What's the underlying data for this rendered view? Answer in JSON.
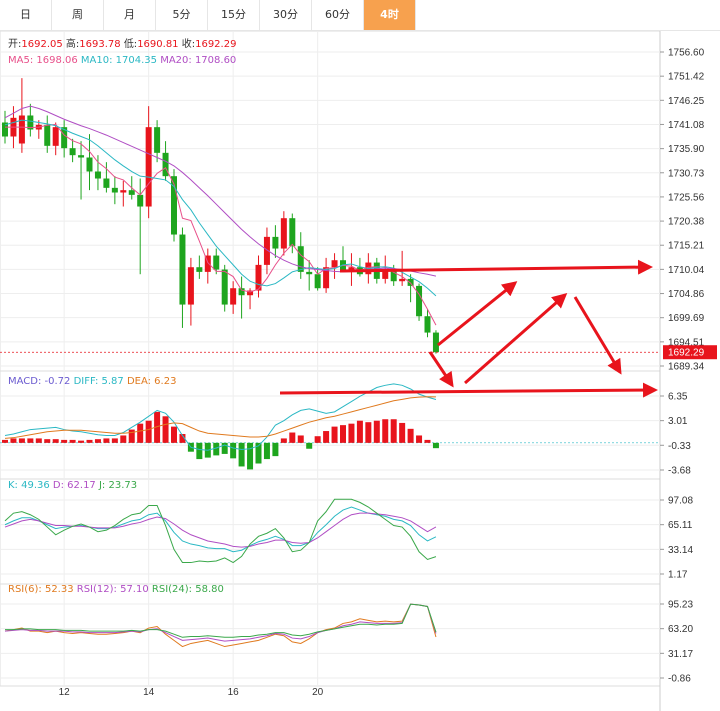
{
  "tabs": [
    {
      "label": "日",
      "active": false
    },
    {
      "label": "周",
      "active": false
    },
    {
      "label": "月",
      "active": false
    },
    {
      "label": "5分",
      "active": false
    },
    {
      "label": "15分",
      "active": false
    },
    {
      "label": "30分",
      "active": false
    },
    {
      "label": "60分",
      "active": false
    },
    {
      "label": "4时",
      "active": true
    }
  ],
  "ohlc_info": [
    {
      "label": "开:",
      "value": "1692.05"
    },
    {
      "label": "高:",
      "value": "1693.78"
    },
    {
      "label": "低:",
      "value": "1690.81"
    },
    {
      "label": "收:",
      "value": "1692.29"
    }
  ],
  "ma_info": [
    {
      "label": "MA5: ",
      "value": "1698.06",
      "color": "#e8508a"
    },
    {
      "label": "MA10: ",
      "value": "1704.35",
      "color": "#2bb8c4"
    },
    {
      "label": "MA20: ",
      "value": "1708.60",
      "color": "#b04ec4"
    }
  ],
  "macd_info": [
    {
      "label": "MACD: ",
      "value": "-0.72",
      "color": "#6b5bd0"
    },
    {
      "label": "DIFF: ",
      "value": "5.87",
      "color": "#2bb8c4"
    },
    {
      "label": "DEA: ",
      "value": "6.23",
      "color": "#e07a1f"
    }
  ],
  "kdj_info": [
    {
      "label": "K: ",
      "value": "49.36",
      "color": "#2bb8c4"
    },
    {
      "label": "D: ",
      "value": "62.17",
      "color": "#b04ec4"
    },
    {
      "label": "J: ",
      "value": "23.73",
      "color": "#3aa84a"
    }
  ],
  "rsi_info": [
    {
      "label": "RSI(6): ",
      "value": "52.33",
      "color": "#e07a1f"
    },
    {
      "label": "RSI(12): ",
      "value": "57.10",
      "color": "#b04ec4"
    },
    {
      "label": "RSI(24): ",
      "value": "58.80",
      "color": "#3aa84a"
    }
  ],
  "colors": {
    "up": "#e8141c",
    "down": "#1ea51e",
    "grid": "#eeeeee",
    "arrow": "#e8141c",
    "price_tag": "#e8141c"
  },
  "chart_data": [
    {
      "type": "candlestick",
      "name": "price",
      "y_ticks": [
        1756.6,
        1751.42,
        1746.25,
        1741.08,
        1735.9,
        1730.73,
        1725.56,
        1720.38,
        1715.21,
        1710.04,
        1704.86,
        1699.69,
        1694.51,
        1689.34
      ],
      "y_range": [
        1689.34,
        1756.6
      ],
      "x_tick_labels": [
        {
          "label": "12",
          "index": 7
        },
        {
          "label": "14",
          "index": 17
        },
        {
          "label": "16",
          "index": 27
        },
        {
          "label": "20",
          "index": 37
        }
      ],
      "current_price": 1692.29,
      "candles": [
        [
          1741.5,
          1744.0,
          1737.0,
          1738.5
        ],
        [
          1738.5,
          1745.0,
          1736.0,
          1742.5
        ],
        [
          1737.0,
          1751.0,
          1735.0,
          1743.0
        ],
        [
          1743.0,
          1745.5,
          1738.5,
          1740.0
        ],
        [
          1740.0,
          1742.0,
          1738.0,
          1741.0
        ],
        [
          1741.0,
          1743.0,
          1735.0,
          1736.5
        ],
        [
          1736.5,
          1741.5,
          1734.5,
          1740.5
        ],
        [
          1740.5,
          1742.0,
          1734.0,
          1736.0
        ],
        [
          1736.0,
          1738.0,
          1733.0,
          1734.5
        ],
        [
          1734.5,
          1737.5,
          1725.0,
          1734.0
        ],
        [
          1734.0,
          1739.0,
          1727.0,
          1731.0
        ],
        [
          1731.0,
          1734.5,
          1727.0,
          1729.5
        ],
        [
          1729.5,
          1733.0,
          1726.5,
          1727.5
        ],
        [
          1727.5,
          1730.0,
          1724.0,
          1726.5
        ],
        [
          1726.5,
          1729.0,
          1723.5,
          1727.0
        ],
        [
          1727.0,
          1730.0,
          1725.0,
          1726.0
        ],
        [
          1726.0,
          1729.5,
          1709.0,
          1723.5
        ],
        [
          1723.5,
          1745.0,
          1721.0,
          1740.5
        ],
        [
          1740.5,
          1742.0,
          1733.0,
          1735.0
        ],
        [
          1735.0,
          1737.5,
          1729.0,
          1730.0
        ],
        [
          1730.0,
          1731.5,
          1716.0,
          1717.5
        ],
        [
          1717.5,
          1719.0,
          1697.5,
          1702.5
        ],
        [
          1702.5,
          1712.5,
          1698.0,
          1710.5
        ],
        [
          1710.5,
          1713.0,
          1708.0,
          1709.5
        ],
        [
          1709.5,
          1714.5,
          1707.0,
          1713.0
        ],
        [
          1713.0,
          1714.5,
          1709.0,
          1710.0
        ],
        [
          1710.0,
          1711.0,
          1701.0,
          1702.5
        ],
        [
          1702.5,
          1707.5,
          1700.5,
          1706.0
        ],
        [
          1706.0,
          1708.5,
          1699.5,
          1704.5
        ],
        [
          1704.5,
          1706.0,
          1701.5,
          1705.5
        ],
        [
          1705.5,
          1713.0,
          1704.0,
          1711.0
        ],
        [
          1711.0,
          1719.0,
          1709.0,
          1717.0
        ],
        [
          1717.0,
          1719.5,
          1712.5,
          1714.5
        ],
        [
          1714.5,
          1722.5,
          1713.0,
          1721.0
        ],
        [
          1721.0,
          1722.0,
          1713.5,
          1715.0
        ],
        [
          1715.0,
          1718.0,
          1708.0,
          1709.5
        ],
        [
          1709.5,
          1712.0,
          1705.5,
          1709.0
        ],
        [
          1709.0,
          1710.5,
          1705.5,
          1706.0
        ],
        [
          1706.0,
          1712.5,
          1705.0,
          1710.5
        ],
        [
          1710.5,
          1713.5,
          1708.0,
          1712.0
        ],
        [
          1712.0,
          1715.0,
          1710.0,
          1709.5
        ],
        [
          1709.5,
          1713.5,
          1706.5,
          1710.5
        ],
        [
          1710.5,
          1712.5,
          1708.5,
          1709.0
        ],
        [
          1709.0,
          1713.5,
          1707.0,
          1711.5
        ],
        [
          1711.5,
          1712.5,
          1707.0,
          1708.0
        ],
        [
          1708.0,
          1713.0,
          1707.0,
          1710.0
        ],
        [
          1710.0,
          1711.0,
          1706.5,
          1707.5
        ],
        [
          1707.5,
          1714.0,
          1706.5,
          1708.0
        ],
        [
          1708.0,
          1709.0,
          1703.0,
          1706.5
        ],
        [
          1706.5,
          1707.0,
          1699.0,
          1700.0
        ],
        [
          1700.0,
          1701.5,
          1695.5,
          1696.5
        ],
        [
          1696.5,
          1697.0,
          1692.0,
          1692.29
        ]
      ],
      "ma5": [
        1740.5,
        1740.5,
        1740.5,
        1740.4,
        1740.5,
        1740.9,
        1741.1,
        1738.8,
        1737.6,
        1736.9,
        1735.3,
        1733.0,
        1731.6,
        1729.8,
        1729.2,
        1727.5,
        1726.0,
        1728.4,
        1730.6,
        1731.8,
        1728.3,
        1721.0,
        1720.5,
        1716.1,
        1711.5,
        1709.6,
        1709.6,
        1708.5,
        1705.6,
        1705.2,
        1705.8,
        1708.1,
        1711.0,
        1713.5,
        1715.4,
        1713.1,
        1711.7,
        1709.0,
        1710.2,
        1710.4,
        1710.9,
        1710.7,
        1709.8,
        1710.5,
        1710.6,
        1710.5,
        1709.4,
        1708.5,
        1707.1,
        1704.7,
        1701.5,
        1698.1
      ],
      "ma10": [
        1741.0,
        1741.5,
        1742.0,
        1741.8,
        1741.5,
        1741.2,
        1740.8,
        1740.0,
        1739.2,
        1738.5,
        1737.8,
        1736.5,
        1735.0,
        1733.5,
        1732.2,
        1731.0,
        1730.0,
        1729.8,
        1729.5,
        1729.2,
        1727.8,
        1725.0,
        1722.8,
        1720.0,
        1717.5,
        1715.0,
        1713.0,
        1711.0,
        1709.0,
        1707.5,
        1706.8,
        1706.5,
        1707.0,
        1708.2,
        1709.5,
        1710.0,
        1710.4,
        1710.2,
        1710.0,
        1710.2,
        1711.0,
        1711.2,
        1710.6,
        1710.2,
        1710.5,
        1710.6,
        1710.3,
        1709.4,
        1708.4,
        1707.4,
        1706.0,
        1704.35
      ],
      "ma20": [
        1742.5,
        1743.5,
        1744.5,
        1745.0,
        1744.5,
        1743.8,
        1743.0,
        1742.2,
        1741.5,
        1740.8,
        1740.2,
        1739.5,
        1738.8,
        1738.0,
        1737.2,
        1736.4,
        1735.6,
        1734.8,
        1734.0,
        1733.2,
        1732.2,
        1730.8,
        1729.2,
        1727.5,
        1725.8,
        1724.0,
        1722.2,
        1720.4,
        1718.6,
        1717.0,
        1715.5,
        1714.2,
        1713.0,
        1712.0,
        1711.2,
        1710.6,
        1710.2,
        1710.0,
        1709.8,
        1709.6,
        1709.5,
        1709.6,
        1709.8,
        1710.0,
        1710.2,
        1710.3,
        1710.2,
        1710.0,
        1709.7,
        1709.3,
        1709.0,
        1708.6
      ]
    },
    {
      "type": "bar",
      "name": "MACD",
      "y_ticks": [
        6.35,
        3.01,
        -0.33,
        -3.68
      ],
      "y_range": [
        -3.68,
        6.35
      ],
      "macd": [
        0.4,
        0.6,
        0.6,
        0.6,
        0.6,
        0.5,
        0.5,
        0.4,
        0.4,
        0.3,
        0.4,
        0.5,
        0.6,
        0.6,
        1.0,
        1.8,
        2.6,
        3.0,
        4.2,
        3.6,
        2.2,
        1.2,
        -1.2,
        -2.2,
        -2.0,
        -1.7,
        -1.5,
        -2.1,
        -3.2,
        -3.6,
        -2.8,
        -2.2,
        -1.8,
        0.6,
        1.4,
        1.0,
        -0.8,
        0.9,
        1.6,
        2.2,
        2.4,
        2.6,
        3.0,
        2.8,
        3.0,
        3.2,
        3.2,
        2.7,
        1.9,
        1.0,
        0.4,
        -0.72
      ],
      "diff": [
        1.0,
        1.2,
        1.5,
        1.8,
        1.9,
        2.0,
        2.1,
        1.8,
        1.6,
        1.5,
        1.3,
        1.1,
        1.0,
        1.0,
        1.4,
        2.1,
        2.8,
        3.6,
        4.4,
        4.0,
        2.8,
        1.0,
        -0.6,
        -0.9,
        -1.0,
        -0.7,
        -0.3,
        -0.7,
        -0.9,
        -0.8,
        -0.4,
        0.8,
        2.4,
        3.0,
        3.8,
        4.4,
        4.6,
        4.3,
        4.0,
        4.2,
        4.9,
        5.6,
        6.3,
        6.9,
        7.5,
        7.8,
        8.0,
        7.8,
        7.3,
        6.6,
        6.2,
        5.87
      ],
      "dea": [
        0.6,
        0.7,
        0.9,
        1.1,
        1.3,
        1.5,
        1.6,
        1.7,
        1.7,
        1.7,
        1.6,
        1.5,
        1.4,
        1.3,
        1.3,
        1.4,
        1.6,
        1.8,
        2.2,
        2.5,
        2.7,
        2.6,
        2.1,
        1.6,
        1.3,
        1.2,
        1.1,
        1.0,
        0.9,
        0.8,
        0.8,
        0.9,
        1.2,
        1.6,
        2.0,
        2.4,
        2.8,
        3.1,
        3.4,
        3.6,
        3.9,
        4.2,
        4.5,
        4.8,
        5.1,
        5.4,
        5.7,
        5.9,
        6.1,
        6.2,
        6.25,
        6.23
      ]
    },
    {
      "type": "line",
      "name": "KDJ",
      "y_ticks": [
        97.08,
        65.11,
        33.14,
        1.17
      ],
      "y_range": [
        1.17,
        97.08
      ],
      "k": [
        65,
        70,
        74,
        74,
        70,
        65,
        60,
        62,
        63,
        64,
        62,
        60,
        60,
        62,
        66,
        70,
        72,
        78,
        80,
        70,
        55,
        44,
        40,
        38,
        35,
        34,
        34,
        30,
        32,
        38,
        43,
        46,
        50,
        46,
        38,
        38,
        42,
        55,
        65,
        76,
        84,
        88,
        84,
        80,
        78,
        76,
        72,
        70,
        64,
        52,
        44,
        49.36
      ],
      "d": [
        62,
        66,
        70,
        72,
        70,
        67,
        64,
        64,
        63,
        63,
        62,
        61,
        61,
        61,
        63,
        66,
        68,
        72,
        75,
        73,
        66,
        58,
        52,
        48,
        44,
        42,
        40,
        37,
        36,
        37,
        40,
        42,
        45,
        45,
        42,
        41,
        42,
        48,
        56,
        64,
        72,
        78,
        80,
        80,
        79,
        78,
        76,
        74,
        70,
        63,
        56,
        62.17
      ],
      "j": [
        70,
        80,
        82,
        78,
        72,
        62,
        52,
        58,
        63,
        66,
        62,
        56,
        58,
        64,
        72,
        78,
        80,
        90,
        90,
        64,
        33,
        16,
        16,
        18,
        17,
        18,
        22,
        16,
        24,
        40,
        50,
        54,
        60,
        48,
        30,
        32,
        42,
        70,
        82,
        98,
        98,
        98,
        94,
        88,
        80,
        72,
        64,
        62,
        50,
        30,
        20,
        23.73
      ]
    },
    {
      "type": "line",
      "name": "RSI",
      "y_ticks": [
        95.23,
        63.2,
        31.17,
        -0.86
      ],
      "y_range": [
        -0.86,
        95.23
      ],
      "rsi6": [
        60,
        62,
        64,
        60,
        60,
        58,
        60,
        58,
        57,
        58,
        57,
        56,
        56,
        57,
        58,
        60,
        58,
        64,
        66,
        56,
        48,
        40,
        44,
        46,
        48,
        44,
        40,
        42,
        44,
        46,
        48,
        52,
        56,
        54,
        46,
        44,
        50,
        58,
        62,
        64,
        70,
        72,
        76,
        74,
        72,
        73,
        72,
        73,
        95,
        94,
        92,
        52.33
      ],
      "rsi12": [
        60,
        61,
        62,
        61,
        61,
        60,
        60,
        60,
        59,
        59,
        58,
        58,
        58,
        58,
        59,
        60,
        59,
        62,
        63,
        58,
        53,
        48,
        49,
        50,
        51,
        49,
        47,
        48,
        49,
        50,
        52,
        54,
        57,
        56,
        51,
        50,
        53,
        58,
        61,
        63,
        67,
        69,
        72,
        71,
        70,
        70,
        70,
        71,
        95,
        94,
        92,
        57.1
      ],
      "rsi24": [
        62,
        62,
        63,
        63,
        62,
        62,
        62,
        61,
        61,
        61,
        60,
        60,
        60,
        60,
        60,
        61,
        60,
        62,
        62,
        60,
        56,
        52,
        53,
        53,
        54,
        53,
        52,
        52,
        53,
        53,
        55,
        56,
        58,
        58,
        55,
        54,
        56,
        59,
        61,
        63,
        65,
        67,
        69,
        69,
        68,
        69,
        69,
        70,
        95,
        94,
        92,
        58.8
      ]
    }
  ]
}
